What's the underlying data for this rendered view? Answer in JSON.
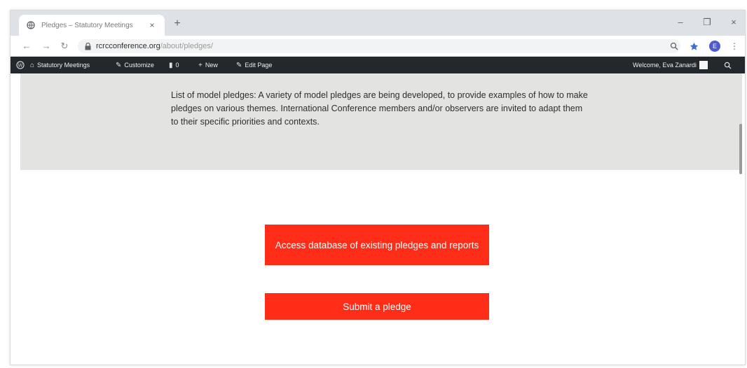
{
  "browser": {
    "tab": {
      "title": "Pledges – Statutory Meetings",
      "close": "×"
    },
    "new_tab": "+",
    "window_controls": {
      "minimize": "–",
      "restore": "❐",
      "close": "×"
    },
    "nav": {
      "back": "←",
      "forward": "→",
      "reload": "↻"
    },
    "url": {
      "host": "rcrcconference.org",
      "path": "/about/pledges/"
    },
    "profile_initial": "E"
  },
  "adminbar": {
    "site_name": "Statutory Meetings",
    "customize": "Customize",
    "comments_count": "0",
    "new": "New",
    "edit_page": "Edit Page",
    "welcome": "Welcome, Eva Zanardi"
  },
  "page": {
    "intro": "List of model pledges: A variety of model pledges are being developed, to provide examples of how to make pledges on various themes. International Conference members and/or observers are invited to adapt them to their specific priorities and contexts.",
    "buttons": {
      "database": "Access database of existing pledges and reports",
      "submit": "Submit a pledge"
    }
  },
  "colors": {
    "accent": "#ff2d17",
    "adminbar": "#23282d",
    "panel": "#e3e3e1"
  }
}
